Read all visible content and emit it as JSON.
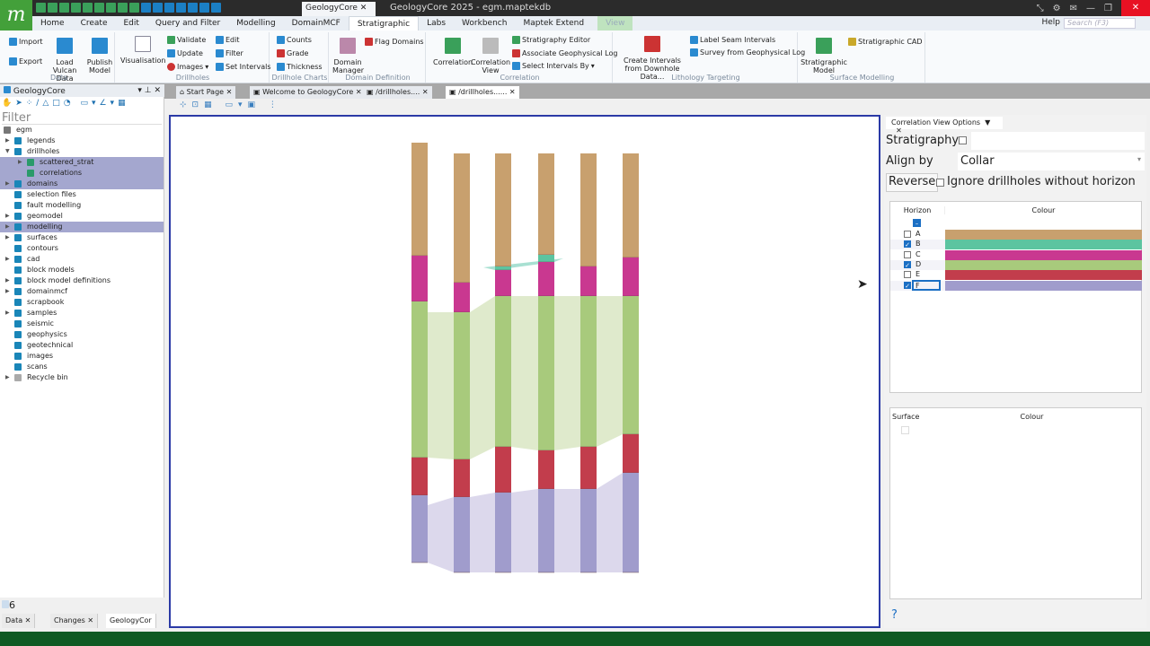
{
  "app": {
    "title": "GeologyCore 2025 - egm.maptekdb",
    "tab": "GeologyCore"
  },
  "ribbon_tabs": [
    "Home",
    "Create",
    "Edit",
    "Query and Filter",
    "Modelling",
    "DomainMCF",
    "Stratigraphic",
    "Labs",
    "Workbench",
    "Maptek Extend",
    "View"
  ],
  "active_tab": "Stratigraphic",
  "help": "Help",
  "search_placeholder": "Search (F3)",
  "groups": {
    "data": {
      "label": "Data",
      "import": "Import",
      "export": "Export",
      "load": "Load Vulcan Data",
      "publish": "Publish Model"
    },
    "drillholes": {
      "label": "Drillholes",
      "visualisation": "Visualisation",
      "validate": "Validate",
      "update": "Update",
      "images": "Images",
      "edit": "Edit",
      "filter": "Filter",
      "set_intervals": "Set Intervals"
    },
    "charts": {
      "label": "Drillhole Charts",
      "counts": "Counts",
      "grade": "Grade",
      "thickness": "Thickness"
    },
    "domain": {
      "label": "Domain Definition",
      "manager": "Domain Manager",
      "flag": "Flag Domains"
    },
    "correlation": {
      "label": "Correlation",
      "correlation": "Correlation",
      "view": "Correlation View",
      "editor": "Stratigraphy Editor",
      "assoc": "Associate Geophysical Log",
      "select": "Select Intervals By"
    },
    "lithology": {
      "label": "Lithology Targeting",
      "create": "Create Intervals from Downhole Data...",
      "label_seam": "Label Seam Intervals",
      "survey": "Survey from Geophysical Log"
    },
    "surface": {
      "label": "Surface Modelling",
      "model": "Stratigraphic Model",
      "cad": "Stratigraphic CAD"
    }
  },
  "left_panel": {
    "title": "GeologyCore",
    "filter_placeholder": "Filter",
    "count": "6",
    "tree": [
      {
        "label": "egm",
        "level": 0,
        "expand": "",
        "sel": false
      },
      {
        "label": "legends",
        "level": 1,
        "expand": "▶",
        "sel": false
      },
      {
        "label": "drillholes",
        "level": 1,
        "expand": "▼",
        "sel": false
      },
      {
        "label": "scattered_strat",
        "level": 2,
        "expand": "▶",
        "sel": true
      },
      {
        "label": "correlations",
        "level": 2,
        "expand": "",
        "sel": true
      },
      {
        "label": "domains",
        "level": 1,
        "expand": "▶",
        "sel": true
      },
      {
        "label": "selection files",
        "level": 1,
        "expand": "",
        "sel": false
      },
      {
        "label": "fault modelling",
        "level": 1,
        "expand": "",
        "sel": false
      },
      {
        "label": "geomodel",
        "level": 1,
        "expand": "▶",
        "sel": false
      },
      {
        "label": "modelling",
        "level": 1,
        "expand": "▶",
        "sel": true
      },
      {
        "label": "surfaces",
        "level": 1,
        "expand": "▶",
        "sel": false
      },
      {
        "label": "contours",
        "level": 1,
        "expand": "",
        "sel": false
      },
      {
        "label": "cad",
        "level": 1,
        "expand": "▶",
        "sel": false
      },
      {
        "label": "block models",
        "level": 1,
        "expand": "",
        "sel": false
      },
      {
        "label": "block model definitions",
        "level": 1,
        "expand": "▶",
        "sel": false
      },
      {
        "label": "domainmcf",
        "level": 1,
        "expand": "▶",
        "sel": false
      },
      {
        "label": "scrapbook",
        "level": 1,
        "expand": "",
        "sel": false
      },
      {
        "label": "samples",
        "level": 1,
        "expand": "▶",
        "sel": false
      },
      {
        "label": "seismic",
        "level": 1,
        "expand": "",
        "sel": false
      },
      {
        "label": "geophysics",
        "level": 1,
        "expand": "",
        "sel": false
      },
      {
        "label": "geotechnical",
        "level": 1,
        "expand": "",
        "sel": false
      },
      {
        "label": "images",
        "level": 1,
        "expand": "",
        "sel": false
      },
      {
        "label": "scans",
        "level": 1,
        "expand": "",
        "sel": false
      },
      {
        "label": "Recycle bin",
        "level": 1,
        "expand": "▶",
        "sel": false
      }
    ],
    "bottom_tabs": [
      "Data",
      "Changes",
      "GeologyCor"
    ]
  },
  "doc_tabs": [
    "Start Page",
    "Welcome to GeologyCore",
    "/drillholes....",
    "/drillholes......"
  ],
  "options": {
    "title": "Correlation View Options",
    "stratigraphy": "Stratigraphy",
    "align_by": "Align by",
    "align_value": "Collar",
    "reverse": "Reverse",
    "ignore": "Ignore drillholes without horizon",
    "horizon_header": "Horizon",
    "colour_header": "Colour",
    "surface_header": "Surface",
    "horizons": [
      {
        "name": "A",
        "checked": false,
        "color": "#c8a06e"
      },
      {
        "name": "B",
        "checked": true,
        "color": "#5cc4a0"
      },
      {
        "name": "C",
        "checked": false,
        "color": "#c93890"
      },
      {
        "name": "D",
        "checked": true,
        "color": "#a8ca7c"
      },
      {
        "name": "E",
        "checked": false,
        "color": "#c23d4c"
      },
      {
        "name": "F",
        "checked": true,
        "color": "#a09ccc"
      }
    ]
  }
}
